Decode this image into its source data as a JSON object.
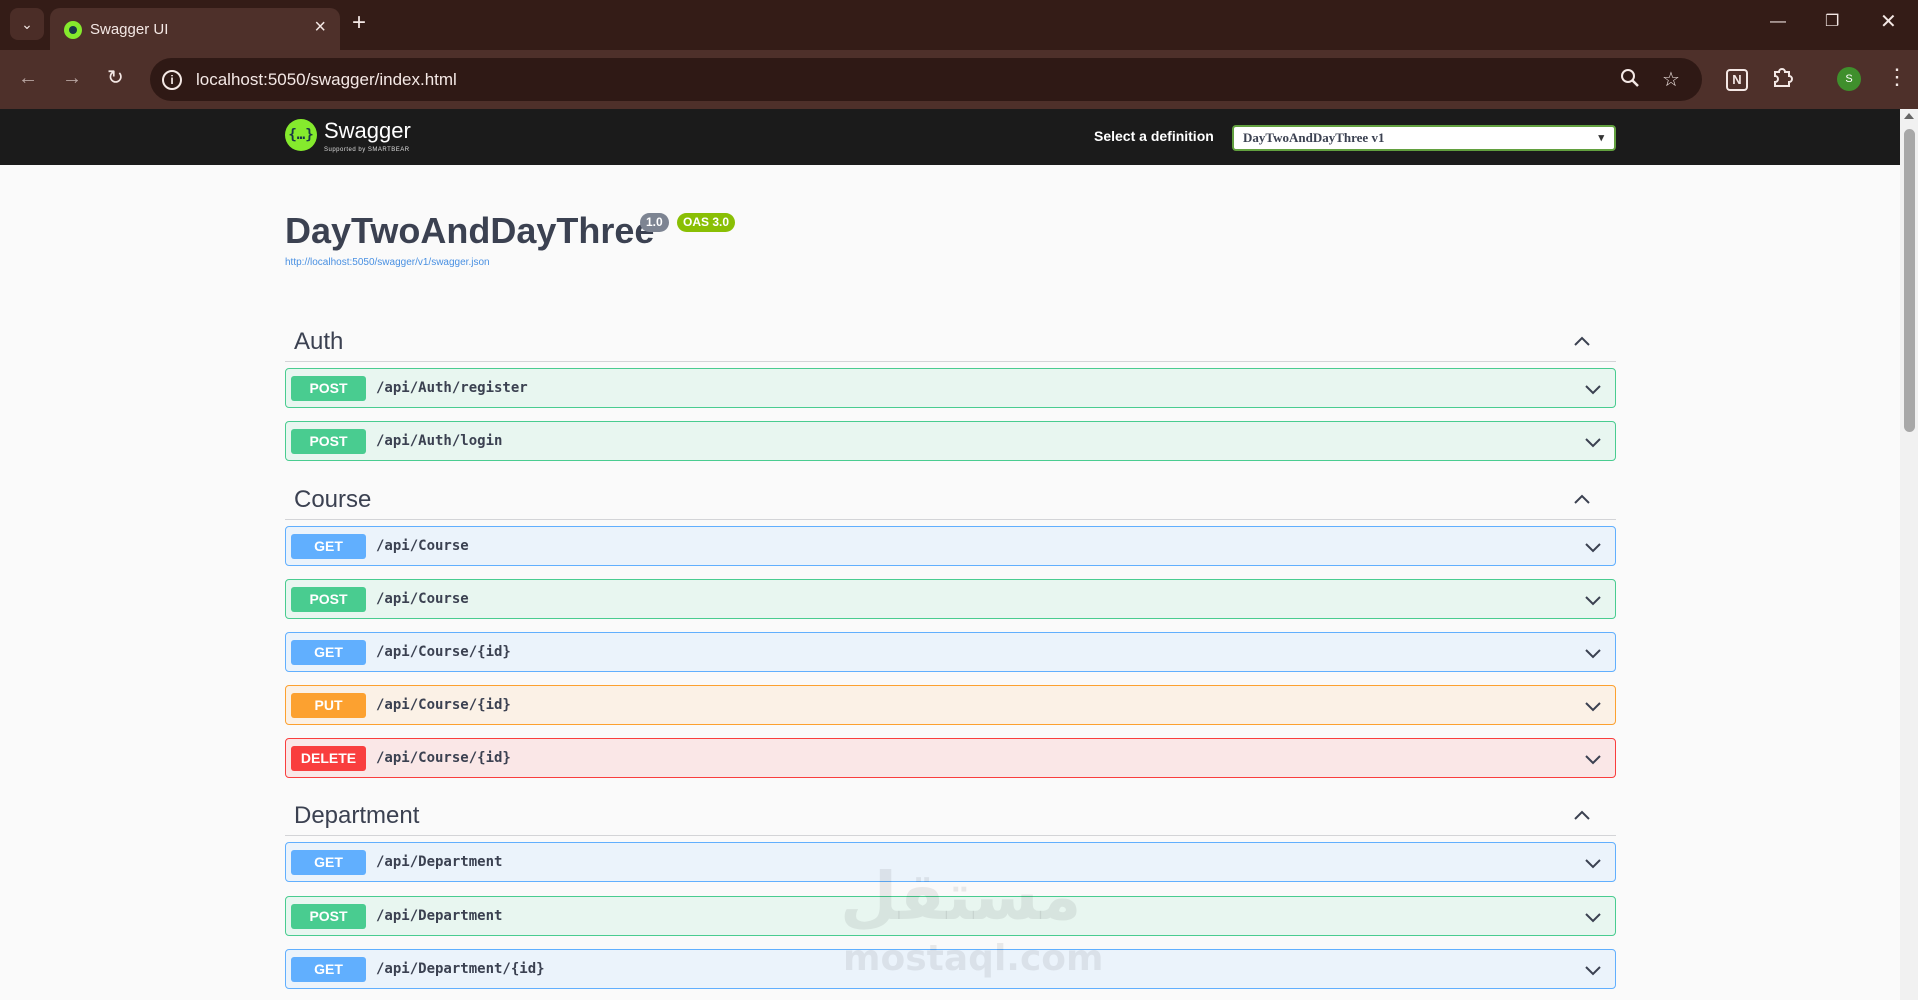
{
  "browser": {
    "tab_title": "Swagger UI",
    "url": "localhost:5050/swagger/index.html",
    "avatar_letter": "S"
  },
  "topbar": {
    "brand": "Swagger",
    "brand_sub": "Supported by SMARTBEAR",
    "definition_label": "Select a definition",
    "definition_selected": "DayTwoAndDayThree v1"
  },
  "info": {
    "title": "DayTwoAndDayThree",
    "version": "1.0",
    "oas": "OAS 3.0",
    "spec_url": "http://localhost:5050/swagger/v1/swagger.json"
  },
  "tags": [
    {
      "name": "Auth",
      "operations": [
        {
          "method": "POST",
          "path": "/api/Auth/register"
        },
        {
          "method": "POST",
          "path": "/api/Auth/login"
        }
      ]
    },
    {
      "name": "Course",
      "operations": [
        {
          "method": "GET",
          "path": "/api/Course"
        },
        {
          "method": "POST",
          "path": "/api/Course"
        },
        {
          "method": "GET",
          "path": "/api/Course/{id}"
        },
        {
          "method": "PUT",
          "path": "/api/Course/{id}"
        },
        {
          "method": "DELETE",
          "path": "/api/Course/{id}"
        }
      ]
    },
    {
      "name": "Department",
      "operations": [
        {
          "method": "GET",
          "path": "/api/Department"
        },
        {
          "method": "POST",
          "path": "/api/Department"
        },
        {
          "method": "GET",
          "path": "/api/Department/{id}"
        }
      ]
    }
  ],
  "watermark": {
    "arabic": "مستقل",
    "latin": "mostaql.com"
  },
  "colors": {
    "post": "#49cc90",
    "get": "#61affe",
    "put": "#fca130",
    "delete": "#f93e3e",
    "swagger_green": "#85ea2d"
  }
}
